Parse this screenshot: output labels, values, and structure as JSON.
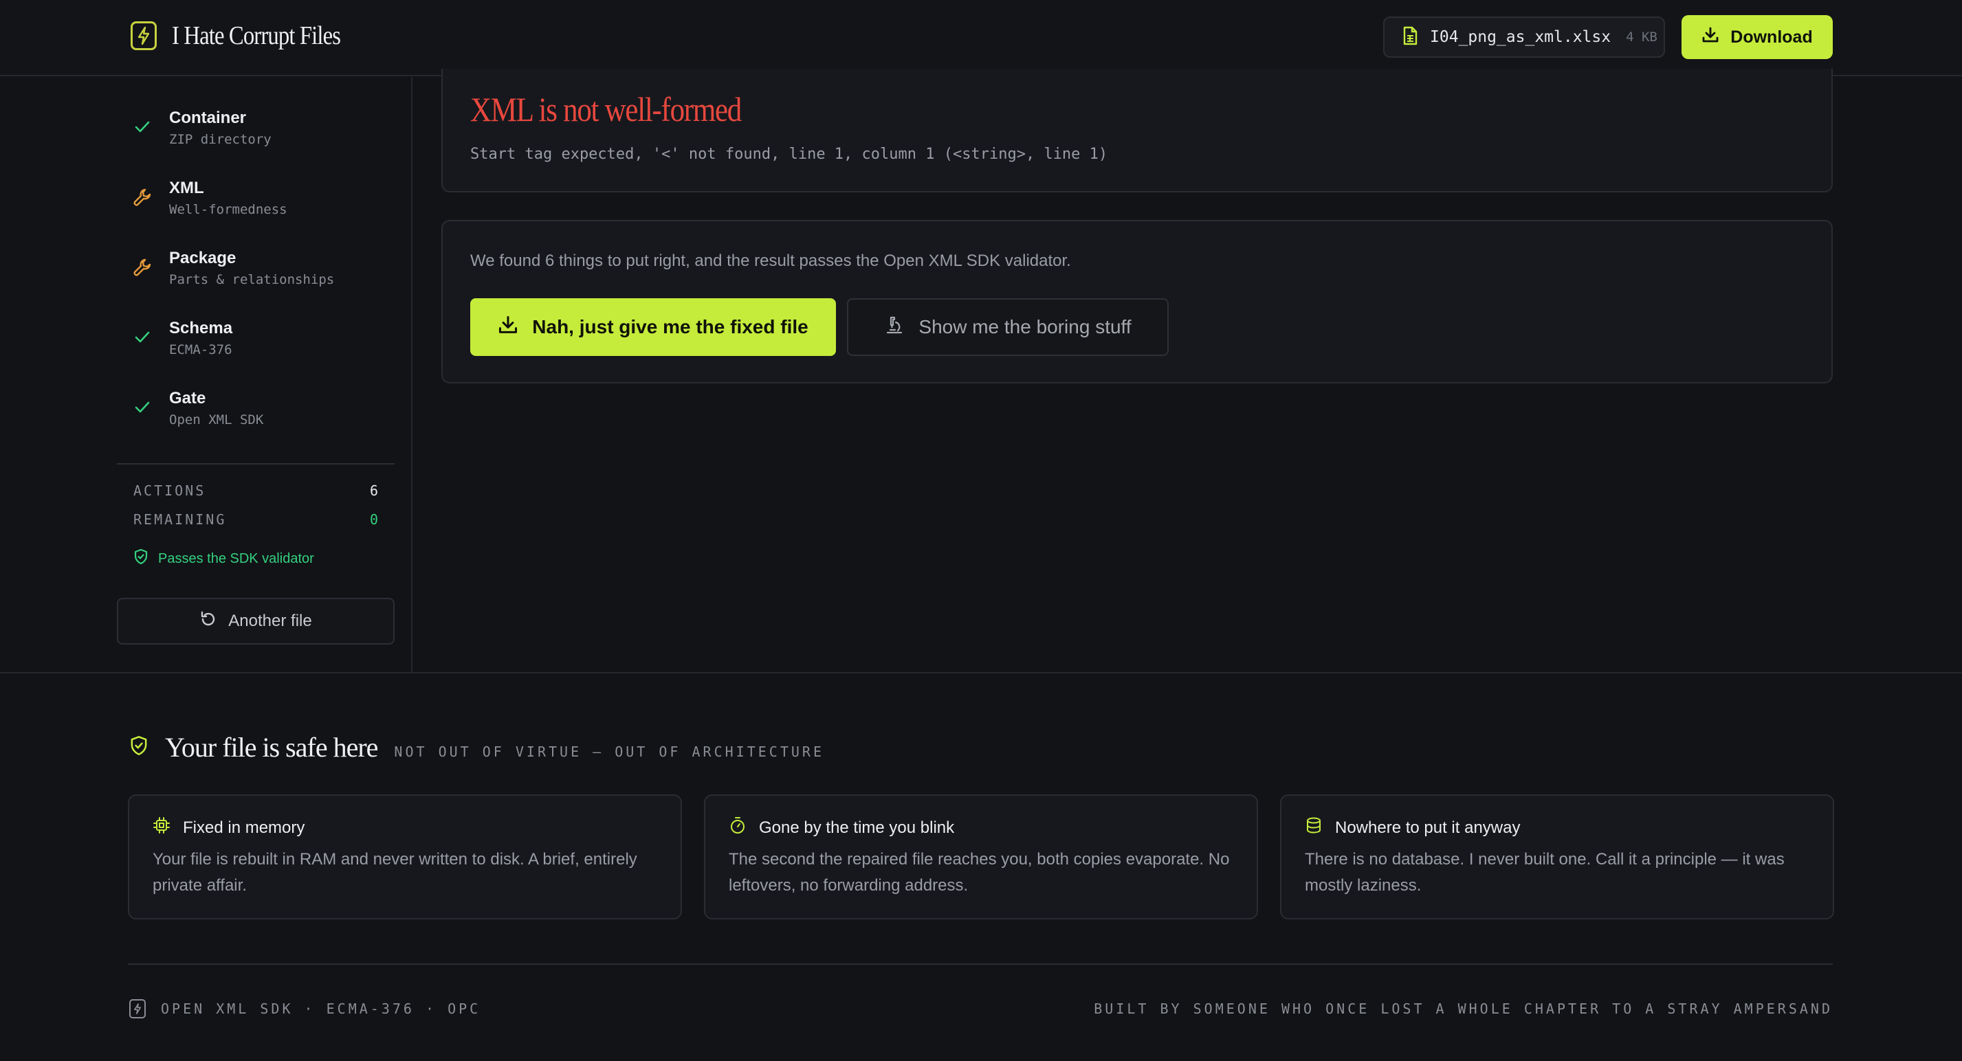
{
  "header": {
    "app_title": "I Hate Corrupt Files",
    "file_name": "I04_png_as_xml.xlsx",
    "file_size": "4 KB",
    "download_label": "Download"
  },
  "sidebar": {
    "steps": [
      {
        "title": "Container",
        "subtitle": "ZIP directory",
        "status": "passed",
        "icon": "check-icon"
      },
      {
        "title": "XML",
        "subtitle": "Well-formedness",
        "status": "repaired",
        "icon": "wrench-icon"
      },
      {
        "title": "Package",
        "subtitle": "Parts & relationships",
        "status": "repaired",
        "icon": "wrench-icon"
      },
      {
        "title": "Schema",
        "subtitle": "ECMA-376",
        "status": "passed",
        "icon": "check-icon"
      },
      {
        "title": "Gate",
        "subtitle": "Open XML SDK",
        "status": "passed",
        "icon": "check-icon"
      }
    ],
    "stats": {
      "actions_label": "ACTIONS",
      "actions_value": "6",
      "remaining_label": "REMAINING",
      "remaining_value": "0"
    },
    "validator_status": "Passes the SDK validator",
    "another_file_label": "Another file"
  },
  "main": {
    "error_title": "XML is not well-formed",
    "error_message": "Start tag expected, '<' not found, line 1, column 1 (<string>, line 1)",
    "fix_summary": "We found 6 things to put right, and the result passes the Open XML SDK validator.",
    "primary_action": "Nah, just give me the fixed file",
    "secondary_action": "Show me the boring stuff"
  },
  "safety": {
    "title": "Your file is safe here",
    "subtitle": "NOT OUT OF VIRTUE — OUT OF ARCHITECTURE",
    "cards": [
      {
        "title": "Fixed in memory",
        "body": "Your file is rebuilt in RAM and never written to disk. A brief, entirely private affair.",
        "icon": "chip-icon"
      },
      {
        "title": "Gone by the time you blink",
        "body": "The second the repaired file reaches you, both copies evaporate. No leftovers, no forwarding address.",
        "icon": "stopwatch-icon"
      },
      {
        "title": "Nowhere to put it anyway",
        "body": "There is no database. I never built one. Call it a principle — it was mostly laziness.",
        "icon": "database-icon"
      }
    ]
  },
  "footer": {
    "left": "OPEN XML SDK · ECMA-376 · OPC",
    "right": "BUILT BY SOMEONE WHO ONCE LOST A WHOLE CHAPTER TO A STRAY AMPERSAND"
  },
  "colors": {
    "accent": "#c5ec3b",
    "error": "#e8483e",
    "success": "#34d17f",
    "warning": "#e39a3b",
    "background": "#121317"
  }
}
